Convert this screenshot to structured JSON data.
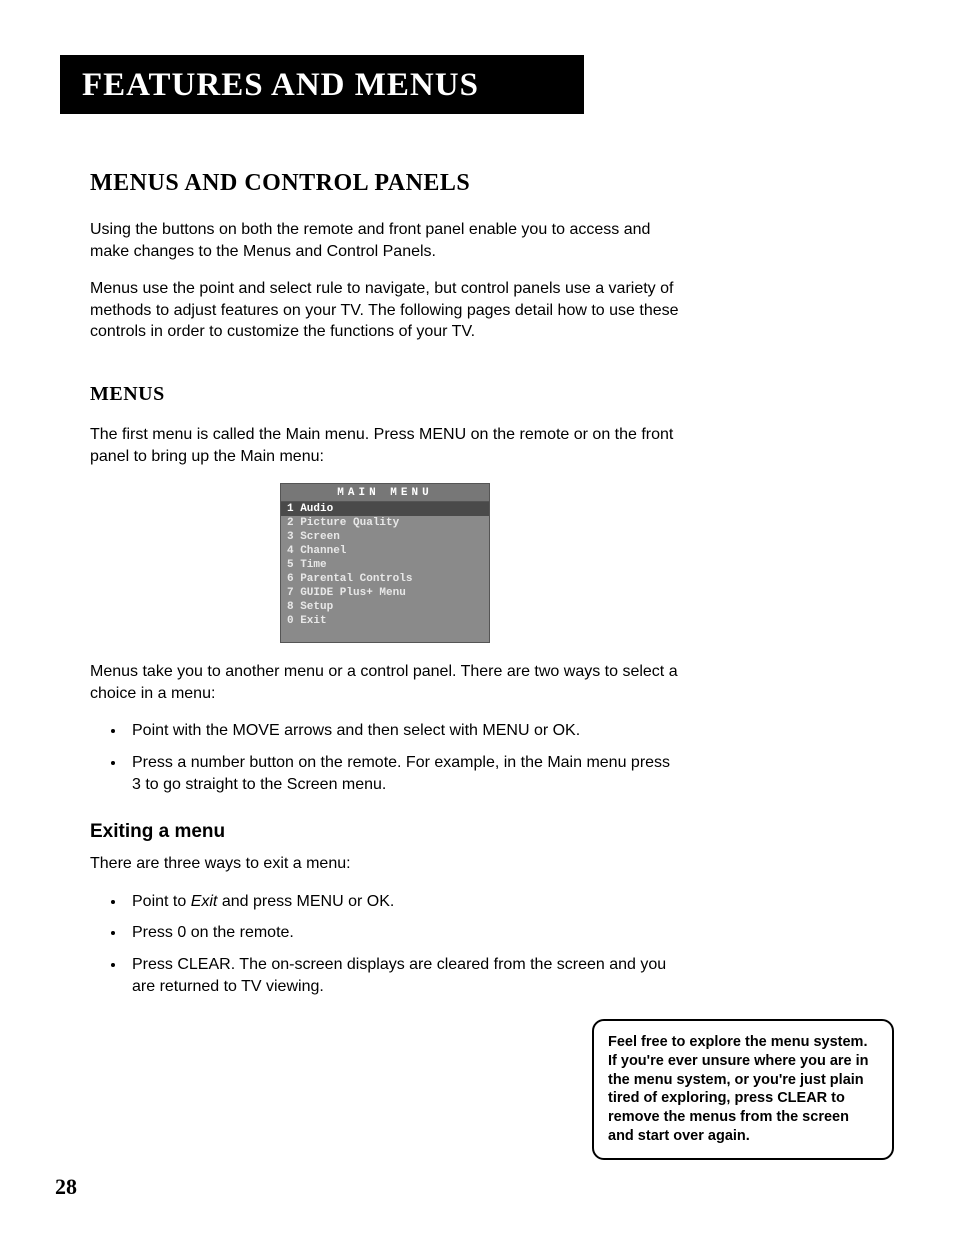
{
  "header": {
    "title": "Features and Menus"
  },
  "section1": {
    "heading": "Menus and Control Panels",
    "para1": "Using the buttons on both the remote and front panel enable you to access and make changes to the Menus and Control Panels.",
    "para2": "Menus use the point and select rule to navigate, but control panels use a variety of methods to adjust features on your TV. The following pages detail how to use these controls in order to customize the functions of your TV."
  },
  "section2": {
    "heading": "Menus",
    "para1": "The first menu is called the Main menu. Press MENU on the remote or on the front panel to bring up the Main menu:",
    "menu": {
      "title": "MAIN MENU",
      "items": [
        {
          "num": "1",
          "label": "Audio",
          "highlight": true
        },
        {
          "num": "2",
          "label": "Picture Quality",
          "highlight": false
        },
        {
          "num": "3",
          "label": "Screen",
          "highlight": false
        },
        {
          "num": "4",
          "label": "Channel",
          "highlight": false
        },
        {
          "num": "5",
          "label": "Time",
          "highlight": false
        },
        {
          "num": "6",
          "label": "Parental Controls",
          "highlight": false
        },
        {
          "num": "7",
          "label": "GUIDE Plus+ Menu",
          "highlight": false
        },
        {
          "num": "8",
          "label": "Setup",
          "highlight": false
        },
        {
          "num": "0",
          "label": "Exit",
          "highlight": false
        }
      ]
    },
    "para2": "Menus take you to another menu or a control panel. There are two ways to select a choice in a menu:",
    "bullets1": [
      "Point with the MOVE arrows and then select with MENU or OK.",
      "Press a number button on the remote. For example, in the Main menu press 3 to go straight to the Screen menu."
    ]
  },
  "section3": {
    "heading": "Exiting a menu",
    "para1": "There are three ways to exit a menu:",
    "bullets": [
      {
        "pre": "Point to ",
        "em": "Exit",
        "post": " and press MENU or OK."
      },
      {
        "pre": "Press 0 on the remote.",
        "em": "",
        "post": ""
      },
      {
        "pre": "Press CLEAR. The on-screen displays are cleared from the screen and you are returned to TV viewing.",
        "em": "",
        "post": ""
      }
    ]
  },
  "tip": {
    "text": "Feel free to explore the menu system. If you're ever unsure where you are in the menu system, or you're just plain tired of exploring, press CLEAR to remove the menus from the screen and start over again."
  },
  "page_number": "28"
}
